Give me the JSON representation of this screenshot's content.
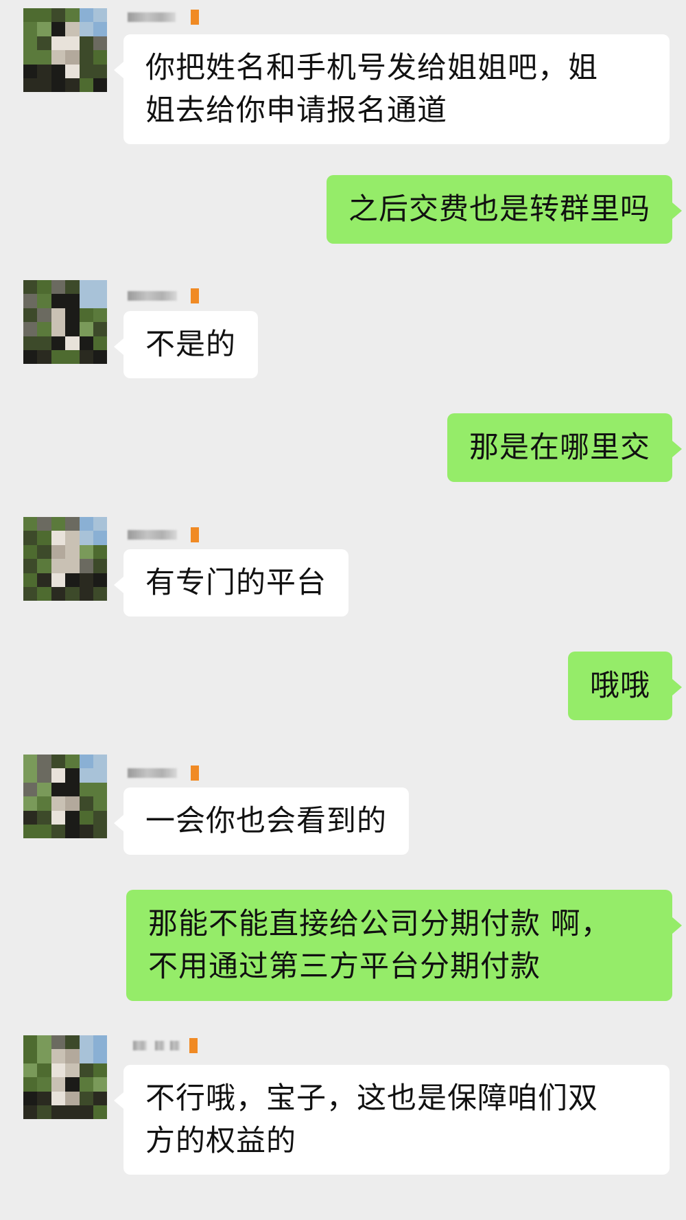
{
  "chat": {
    "messages": [
      {
        "id": "m1",
        "side": "left",
        "text": "你把姓名和手机号发给姐姐吧，姐\n姐去给你申请报名通道"
      },
      {
        "id": "m2",
        "side": "right",
        "text": "之后交费也是转群里吗"
      },
      {
        "id": "m3",
        "side": "left",
        "text": "不是的"
      },
      {
        "id": "m4",
        "side": "right",
        "text": "那是在哪里交"
      },
      {
        "id": "m5",
        "side": "left",
        "text": "有专门的平台"
      },
      {
        "id": "m6",
        "side": "right",
        "text": "哦哦"
      },
      {
        "id": "m7",
        "side": "left",
        "text": "一会你也会看到的"
      },
      {
        "id": "m8",
        "side": "right",
        "text": "那能不能直接给公司分期付款 啊，\n不用通过第三方平台分期付款"
      },
      {
        "id": "m9",
        "side": "left",
        "text": "不行哦，宝子，这也是保障咱们双\n方的权益的"
      }
    ]
  },
  "colors": {
    "background": "#ededed",
    "incoming_bubble": "#ffffff",
    "outgoing_bubble": "#95ec69",
    "name_badge": "#f08a24"
  },
  "icons": {
    "sender_avatar": "pixelated-avatar-icon"
  }
}
